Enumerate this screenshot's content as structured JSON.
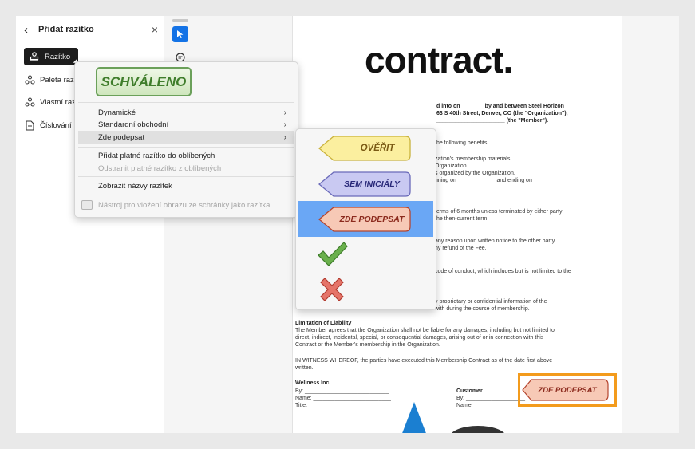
{
  "panel": {
    "title": "Přidat razítko",
    "items": [
      {
        "label": "Razítko",
        "icon": "stamp-icon"
      },
      {
        "label": "Paleta razítek",
        "icon": "stamp-icon"
      },
      {
        "label": "Vlastní razítka",
        "icon": "stamp-icon"
      },
      {
        "label": "Číslování Batesovým kódem",
        "icon": "document-icon"
      }
    ]
  },
  "document": {
    "title": "contract.",
    "intro": [
      "d into on _______ by and between Steel Horizon",
      "63 S 40th Street, Denver, CO (the \"Organization\"),",
      "______________________ (the \"Member\")."
    ],
    "lines": [
      "the following benefits:",
      "zation's membership materials.",
      "Organization.",
      "s organized by the Organization.",
      "nning on ____________ and ending on",
      "terms of 6 months unless terminated by either party",
      "the then-current term.",
      "any reason upon written notice to the other party.",
      "ny refund of the Fee.",
      "code of conduct, which includes but is not limited to the",
      "y proprietary or confidential information of the",
      "with during the course of membership."
    ],
    "liability_heading": "Limitation of Liability",
    "liability_text": [
      "The Member agrees that the Organization shall not be liable for any damages, including but not limited to",
      "direct, indirect, incidental, special, or consequential damages, arising out of or in connection with this",
      "Contract or the Member's membership in the Organization."
    ],
    "witness": [
      "IN WITNESS WHEREOF, the parties have executed this Membership Contract as of the date first above",
      "written."
    ],
    "party_left": {
      "name": "Wellness Inc.",
      "by": "By: ___________________________",
      "name_line": "Name: _________________________",
      "title_line": "Title: _________________________"
    },
    "party_right": {
      "name": "Customer",
      "by": "By: ___________________",
      "name_line": "Name: _________________________"
    },
    "placed_stamp": "ZDE PODEPSAT"
  },
  "menu": {
    "approved_stamp": "SCHVÁLENO",
    "items": [
      {
        "label": "Dynamické",
        "arrow": "›"
      },
      {
        "label": "Standardní obchodní",
        "arrow": "›"
      },
      {
        "label": "Zde podepsat",
        "arrow": "›"
      },
      {
        "label": "Přidat platné razítko do oblíbených"
      },
      {
        "label": "Odstranit platné razítko z oblíbených"
      },
      {
        "label": "Zobrazit názvy razítek"
      },
      {
        "label": "Nástroj pro vložení obrazu ze schránky jako razítka"
      }
    ]
  },
  "submenu": {
    "stamps": [
      "OVĚŘIT",
      "SEM INICIÁLY",
      "ZDE PODEPSAT"
    ],
    "icons": [
      "checkmark-icon",
      "x-mark-icon"
    ]
  },
  "colors": {
    "accent": "#1473e6",
    "selection": "#6aa7f5",
    "highlight": "#f39b1c"
  }
}
